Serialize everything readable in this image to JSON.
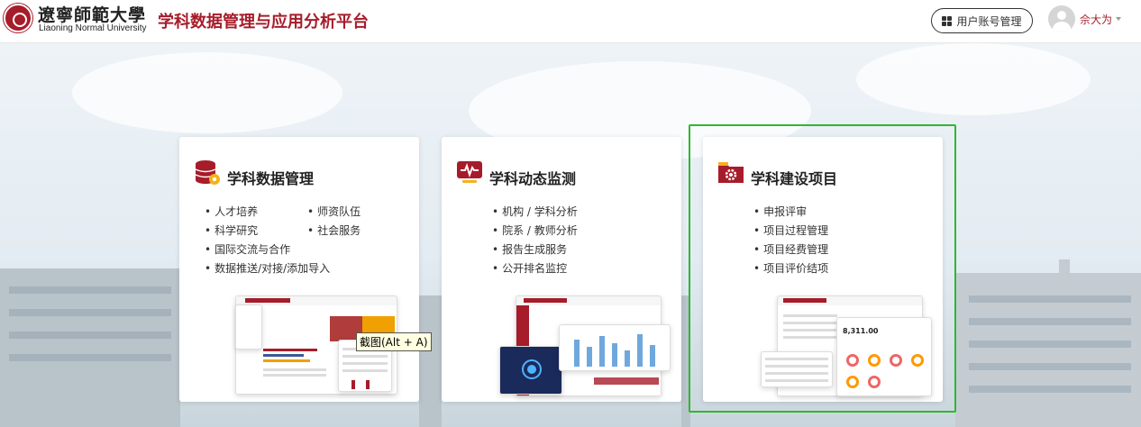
{
  "header": {
    "university_cn": "遼寧師範大學",
    "university_en": "Liaoning Normal University",
    "app_title": "学科数据管理与应用分析平台",
    "account_button": "用户账号管理",
    "username": "佘大为"
  },
  "cards": [
    {
      "title": "学科数据管理",
      "icon": "database-gear-icon",
      "items_left": [
        "人才培养",
        "科学研究",
        "国际交流与合作",
        "数据推送/对接/添加导入"
      ],
      "items_right": [
        "师资队伍",
        "社会服务"
      ]
    },
    {
      "title": "学科动态监测",
      "icon": "monitor-pulse-icon",
      "items_left": [
        "机构 / 学科分析",
        "院系 / 教师分析",
        "报告生成服务",
        "公开排名监控"
      ]
    },
    {
      "title": "学科建设项目",
      "icon": "folder-gear-icon",
      "items_left": [
        "申报评审",
        "项目过程管理",
        "项目经费管理",
        "项目评价结项"
      ],
      "preview_value": "8,311.00"
    }
  ],
  "tooltip": "截图(Alt + A)",
  "colors": {
    "brand": "#a61c2a",
    "selection": "#2eb82e"
  }
}
